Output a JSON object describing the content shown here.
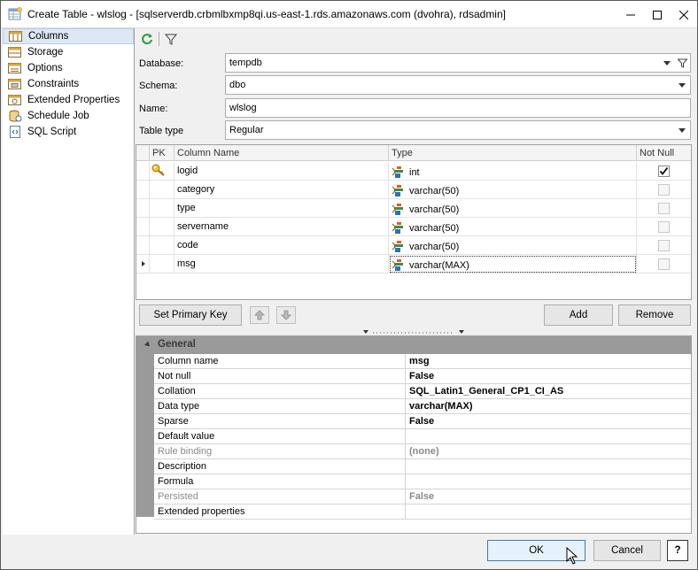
{
  "window": {
    "title": "Create Table - wlslog - [sqlserverdb.crbmlbxmp8qi.us-east-1.rds.amazonaws.com (dvohra), rdsadmin]"
  },
  "nav": {
    "items": [
      {
        "label": "Columns",
        "icon": "columns-icon"
      },
      {
        "label": "Storage",
        "icon": "storage-icon"
      },
      {
        "label": "Options",
        "icon": "options-icon"
      },
      {
        "label": "Constraints",
        "icon": "constraints-icon"
      },
      {
        "label": "Extended Properties",
        "icon": "extended-properties-icon"
      },
      {
        "label": "Schedule Job",
        "icon": "schedule-job-icon"
      },
      {
        "label": "SQL Script",
        "icon": "sql-script-icon"
      }
    ],
    "selected": "Columns"
  },
  "form": {
    "database_label": "Database:",
    "database_value": "tempdb",
    "schema_label": "Schema:",
    "schema_value": "dbo",
    "name_label": "Name:",
    "name_value": "wlslog",
    "table_type_label": "Table type",
    "table_type_value": "Regular"
  },
  "grid": {
    "headers": {
      "pk": "PK",
      "name": "Column Name",
      "type": "Type",
      "notnull": "Not Null"
    },
    "rows": [
      {
        "name": "logid",
        "type": "int",
        "pk": true,
        "notnull": true
      },
      {
        "name": "category",
        "type": "varchar(50)",
        "pk": false,
        "notnull": false
      },
      {
        "name": "type",
        "type": "varchar(50)",
        "pk": false,
        "notnull": false
      },
      {
        "name": "servername",
        "type": "varchar(50)",
        "pk": false,
        "notnull": false
      },
      {
        "name": "code",
        "type": "varchar(50)",
        "pk": false,
        "notnull": false
      },
      {
        "name": "msg",
        "type": "varchar(MAX)",
        "pk": false,
        "notnull": false
      }
    ],
    "current_row": 5
  },
  "buttons": {
    "set_primary_key": "Set Primary Key",
    "add": "Add",
    "remove": "Remove",
    "ok": "OK",
    "cancel": "Cancel",
    "help": "?"
  },
  "properties": {
    "category": "General",
    "rows": [
      {
        "name": "Column name",
        "value": "msg",
        "dim": false
      },
      {
        "name": "Not null",
        "value": "False",
        "dim": false
      },
      {
        "name": "Collation",
        "value": "SQL_Latin1_General_CP1_CI_AS",
        "dim": false
      },
      {
        "name": "Data type",
        "value": "varchar(MAX)",
        "dim": false
      },
      {
        "name": "Sparse",
        "value": "False",
        "dim": false
      },
      {
        "name": "Default value",
        "value": "",
        "dim": false
      },
      {
        "name": "Rule binding",
        "value": "(none)",
        "dim": true
      },
      {
        "name": "Description",
        "value": "",
        "dim": false
      },
      {
        "name": "Formula",
        "value": "",
        "dim": false
      },
      {
        "name": "Persisted",
        "value": "False",
        "dim": true
      },
      {
        "name": "Extended properties",
        "value": "",
        "dim": false
      }
    ]
  },
  "colors": {
    "selection": "#dde8f5",
    "prop_gutter": "#9a9a9a",
    "ok_border": "#3c7fb1"
  }
}
